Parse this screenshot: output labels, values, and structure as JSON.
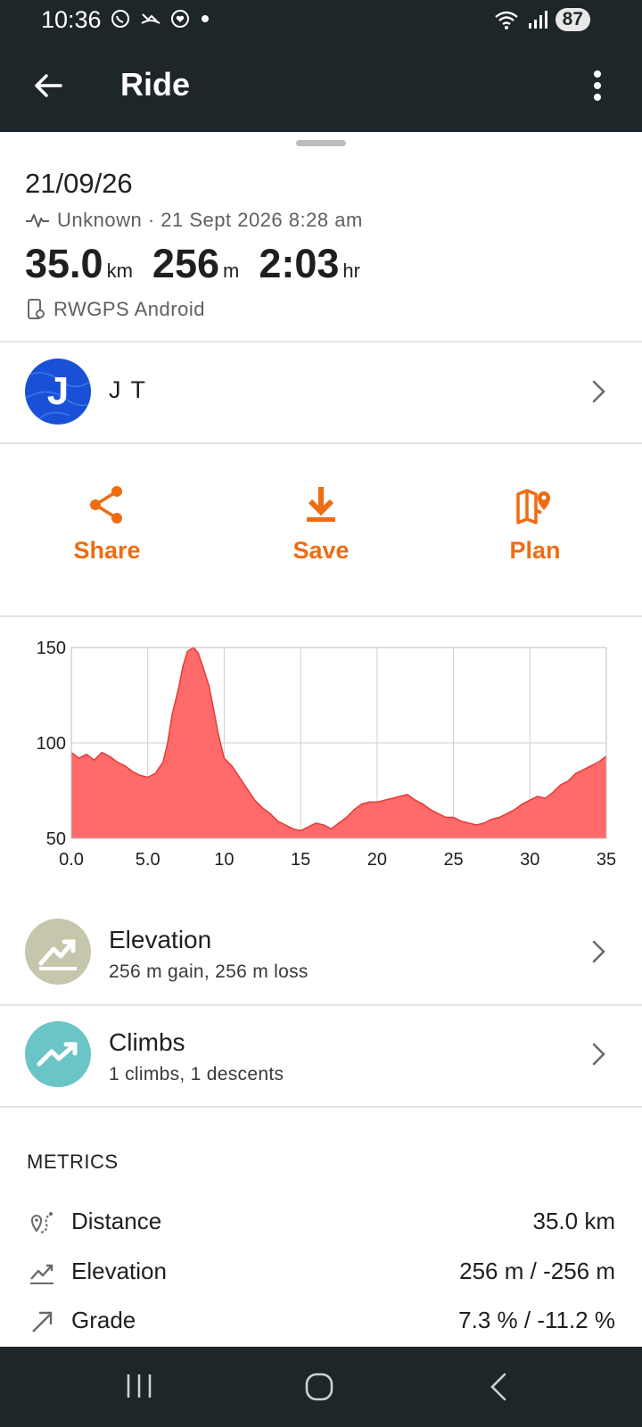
{
  "status": {
    "time": "10:36",
    "notif_icons": [
      "whatsapp-icon",
      "missed-call-icon",
      "heart-app-icon",
      "dot-icon"
    ],
    "battery": "87"
  },
  "appbar": {
    "title": "Ride"
  },
  "summary": {
    "date": "21/09/26",
    "meta": "Unknown · 21 Sept 2026 8:28 am",
    "distance": "35.0",
    "distance_unit": "km",
    "elevation": "256",
    "elevation_unit": "m",
    "duration": "2:03",
    "duration_unit": "hr",
    "device": "RWGPS Android"
  },
  "user": {
    "initial": "J",
    "name": "J T"
  },
  "actions": {
    "share": "Share",
    "save": "Save",
    "plan": "Plan",
    "accent": "#ef6c12"
  },
  "chart_data": {
    "type": "area",
    "ylim": [
      50,
      150
    ],
    "xlim": [
      0,
      35
    ],
    "yticks": [
      "50",
      "100",
      "150"
    ],
    "xticks": [
      "0.0",
      "5.0",
      "10",
      "15",
      "20",
      "25",
      "30",
      "35"
    ],
    "grid": true,
    "series": [
      {
        "color": "#ff6363",
        "x": [
          0,
          0.5,
          1,
          1.5,
          2,
          2.5,
          3,
          3.5,
          4,
          4.5,
          5,
          5.5,
          6,
          6.3,
          6.6,
          7,
          7.3,
          7.6,
          8,
          8.3,
          8.6,
          9,
          9.3,
          9.6,
          10,
          10.5,
          11,
          11.5,
          12,
          12.5,
          13,
          13.5,
          14,
          14.5,
          15,
          15.5,
          16,
          16.5,
          17,
          17.5,
          18,
          18.5,
          19,
          19.5,
          20,
          20.5,
          21,
          21.5,
          22,
          22.5,
          23,
          23.5,
          24,
          24.5,
          25,
          25.5,
          26,
          26.5,
          27,
          27.5,
          28,
          28.5,
          29,
          29.5,
          30,
          30.5,
          31,
          31.5,
          32,
          32.5,
          33,
          33.5,
          34,
          34.5,
          35
        ],
        "y": [
          95,
          92,
          94,
          91,
          95,
          93,
          90,
          88,
          85,
          83,
          82,
          84,
          90,
          100,
          115,
          128,
          140,
          148,
          150,
          147,
          140,
          130,
          118,
          105,
          92,
          88,
          82,
          76,
          70,
          66,
          63,
          59,
          57,
          55,
          54,
          56,
          58,
          57,
          55,
          58,
          61,
          65,
          68,
          69,
          69,
          70,
          71,
          72,
          73,
          70,
          68,
          65,
          63,
          61,
          61,
          59,
          58,
          57,
          58,
          60,
          61,
          63,
          65,
          68,
          70,
          72,
          71,
          74,
          78,
          80,
          84,
          86,
          88,
          90,
          93
        ]
      }
    ]
  },
  "rows": {
    "elevation_title": "Elevation",
    "elevation_sub": "256 m gain, 256 m loss",
    "climbs_title": "Climbs",
    "climbs_sub": "1 climbs, 1 descents",
    "elevation_color": "#c6c6ad",
    "climbs_color": "#6bc4c6"
  },
  "metrics": {
    "title": "METRICS",
    "items": [
      {
        "label": "Distance",
        "value": "35.0 km",
        "icon": "distance-icon"
      },
      {
        "label": "Elevation",
        "value": "256 m / -256 m",
        "icon": "elevation-trend-icon"
      },
      {
        "label": "Grade",
        "value": "7.3 % / -11.2 %",
        "icon": "grade-arrow-icon"
      }
    ]
  }
}
